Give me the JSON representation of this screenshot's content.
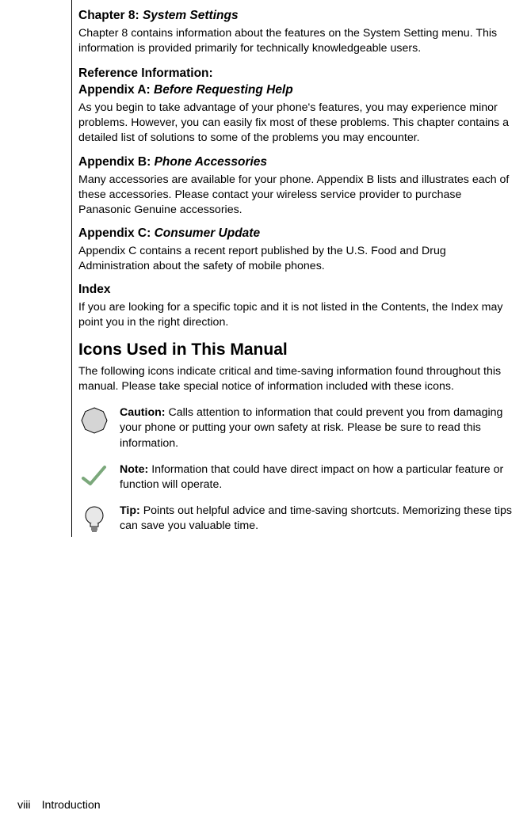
{
  "sections": {
    "chapter8": {
      "heading_prefix": "Chapter 8: ",
      "heading_italic": "System Settings",
      "body": "Chapter 8 contains information about the features on the System Setting menu. This information is provided primarily for technically knowledgeable users."
    },
    "refinfo": {
      "line1": "Reference Information:",
      "line2_prefix": "Appendix A: ",
      "line2_italic": "Before Requesting Help",
      "body": "As you begin to take advantage of your phone's features, you may experience minor problems. However, you can easily fix most of these problems. This chapter contains a detailed list of solutions to some of the problems you may encounter."
    },
    "appendixB": {
      "heading_prefix": "Appendix B: ",
      "heading_italic": "Phone Accessories",
      "body": "Many accessories are available for your phone. Appendix B lists and illustrates each of these accessories. Please contact your wireless service provider to purchase Panasonic Genuine accessories."
    },
    "appendixC": {
      "heading_prefix": "Appendix C: ",
      "heading_italic": "Consumer Update",
      "body": "Appendix C contains a recent report published by the U.S. Food and Drug Administration about the safety of mobile phones."
    },
    "index": {
      "heading": "Index",
      "body": "If you are looking for a specific topic and it is not listed in the Contents, the Index may point you in the right direction."
    },
    "icons_section": {
      "heading": "Icons Used in This Manual",
      "intro": "The following icons indicate critical and time-saving information found throughout this manual. Please take special notice of information included with these icons."
    },
    "icon_caution": {
      "label": "Caution:",
      "text": " Calls attention to information that could prevent you from damaging your phone or putting your own safety at risk. Please be sure to read this information."
    },
    "icon_note": {
      "label": "Note:",
      "text": " Information that could have direct impact on how a particular feature or function will operate."
    },
    "icon_tip": {
      "label": "Tip:",
      "text": " Points out helpful advice and time-saving shortcuts. Memorizing these tips can save you valuable time."
    }
  },
  "footer": {
    "page": "viii",
    "title": "Introduction"
  }
}
